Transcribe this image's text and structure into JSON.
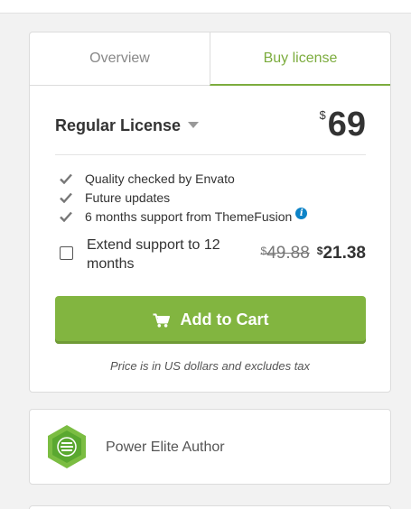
{
  "tabs": [
    {
      "label": "Overview",
      "active": false
    },
    {
      "label": "Buy license",
      "active": true
    }
  ],
  "license": {
    "name": "Regular License",
    "currency_symbol": "$",
    "price": "69"
  },
  "features": [
    {
      "text": "Quality checked by Envato",
      "icon": "check-icon"
    },
    {
      "text": "Future updates",
      "icon": "check-icon"
    },
    {
      "text": "6 months support from ThemeFusion",
      "icon": "check-icon",
      "info_icon": "i"
    }
  ],
  "extend_support": {
    "label": "Extend support to 12 months",
    "checked": false,
    "old_price": "49.88",
    "new_price": "21.38",
    "currency_symbol": "$"
  },
  "add_to_cart": {
    "label": "Add to Cart",
    "icon": "cart-icon"
  },
  "price_note": "Price is in US dollars and excludes tax",
  "author": {
    "label": "Power Elite Author",
    "icon": "power-elite-badge-icon"
  },
  "colors": {
    "accent": "#82b540",
    "tab_active": "#7cac3e",
    "info": "#0d83c7",
    "badge": "#7bbd42"
  }
}
